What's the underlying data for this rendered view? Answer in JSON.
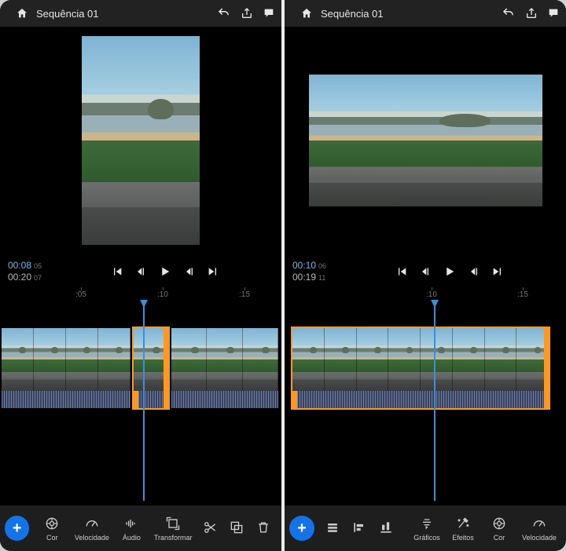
{
  "left": {
    "title": "Sequência 01",
    "time_current": "00:08",
    "time_current_frames": "05",
    "time_total": "00:20",
    "time_total_frames": "07",
    "ticks": [
      ":05",
      ":10",
      ":15"
    ],
    "toolbar": [
      {
        "name": "cor",
        "label": "Cor"
      },
      {
        "name": "velocidade",
        "label": "Velocidade"
      },
      {
        "name": "audio",
        "label": "Áudio"
      },
      {
        "name": "transformar",
        "label": "Transformar"
      }
    ]
  },
  "right": {
    "title": "Sequência 01",
    "time_current": "00:10",
    "time_current_frames": "06",
    "time_total": "00:19",
    "time_total_frames": "11",
    "ticks": [
      ":10",
      ":15"
    ],
    "toolbar": [
      {
        "name": "graficos",
        "label": "Gráficos"
      },
      {
        "name": "efeitos",
        "label": "Efeitos"
      },
      {
        "name": "cor",
        "label": "Cor"
      },
      {
        "name": "velocidade",
        "label": "Velocidade"
      }
    ]
  }
}
